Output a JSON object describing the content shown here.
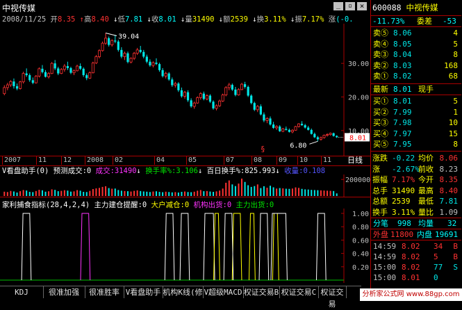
{
  "window": {
    "title": "中视传媒",
    "stock_code": "600088",
    "stock_name": "中视传媒"
  },
  "window_controls": {
    "minimize": "_",
    "restore": "▫",
    "close": "×"
  },
  "info_bar": {
    "date": "2008/11/25",
    "open_label": "开",
    "open": "8.35",
    "high_label": "高",
    "high": "8.40",
    "low_label": "低",
    "low": "7.81",
    "close_label": "收",
    "close": "8.01",
    "volume_label": "量",
    "volume": "31490",
    "amount_label": "额",
    "amount": "2539",
    "turnover_label": "换",
    "turnover": "3.11%",
    "amplitude_label": "振",
    "amplitude": "7.17%",
    "change_label": "涨",
    "change": "(-0."
  },
  "price_chart": {
    "y_ticks": [
      "30.00",
      "20.00",
      "10.00"
    ],
    "max_label": "39.04",
    "min_label": "6.80",
    "current_price": "8.01",
    "marker": "§",
    "x_labels": [
      "2007",
      "11",
      "12",
      "2008",
      "02",
      "04",
      "05",
      "07",
      "08",
      "09",
      "10",
      "11"
    ],
    "period_label": "日线",
    "y_domain": [
      5,
      41
    ],
    "candles": [
      [
        21,
        23.5,
        20.5,
        22.8
      ],
      [
        22.8,
        24.2,
        22.0,
        23.6
      ],
      [
        23.6,
        25.0,
        23.0,
        24.6
      ],
      [
        24.6,
        25.5,
        22.5,
        23.2
      ],
      [
        23.2,
        24.0,
        22.0,
        22.5
      ],
      [
        22.5,
        24.8,
        22.2,
        24.5
      ],
      [
        24.5,
        27.5,
        24.0,
        27.0
      ],
      [
        27,
        28.5,
        26.0,
        26.5
      ],
      [
        26.5,
        27.0,
        24.5,
        25.0
      ],
      [
        25,
        25.8,
        23.8,
        24.2
      ],
      [
        24.2,
        26.5,
        24.0,
        26.2
      ],
      [
        26.2,
        28.8,
        25.8,
        28.4
      ],
      [
        28.4,
        29.5,
        27.0,
        27.4
      ],
      [
        27.4,
        28.0,
        25.8,
        26.0
      ],
      [
        26,
        27.4,
        25.5,
        27.0
      ],
      [
        27,
        30.4,
        26.8,
        30.0
      ],
      [
        30,
        31.0,
        28.0,
        28.5
      ],
      [
        28.5,
        29.0,
        26.5,
        27.0
      ],
      [
        27,
        28.6,
        26.8,
        28.2
      ],
      [
        28.2,
        29.8,
        27.5,
        29.2
      ],
      [
        29.2,
        30.5,
        28.0,
        28.6
      ],
      [
        28.6,
        29.0,
        26.8,
        27.2
      ],
      [
        27.2,
        28.2,
        26.5,
        27.8
      ],
      [
        27.8,
        29.6,
        27.6,
        29.2
      ],
      [
        29.2,
        30.0,
        28.0,
        28.4
      ],
      [
        28.4,
        28.8,
        26.0,
        26.5
      ],
      [
        26.5,
        27.0,
        25.0,
        25.6
      ],
      [
        25.6,
        27.6,
        25.4,
        27.2
      ],
      [
        27.2,
        30.5,
        27.0,
        30.1
      ],
      [
        30.1,
        32.5,
        29.8,
        32.0
      ],
      [
        32,
        34.2,
        31.5,
        33.8
      ],
      [
        33.8,
        36.5,
        33.5,
        36.0
      ],
      [
        36,
        39.04,
        35.5,
        37.5
      ],
      [
        37.5,
        38.0,
        35.0,
        35.5
      ],
      [
        35.5,
        37.2,
        35.0,
        36.8
      ],
      [
        36.8,
        38.5,
        36.0,
        36.5
      ],
      [
        36.5,
        37.0,
        33.5,
        34.0
      ],
      [
        34,
        34.8,
        31.5,
        32.0
      ],
      [
        32,
        33.5,
        31.0,
        33.0
      ],
      [
        33,
        33.5,
        30.0,
        30.4
      ],
      [
        30.4,
        31.8,
        30.0,
        31.5
      ],
      [
        31.5,
        33.4,
        31.0,
        33.0
      ],
      [
        33,
        34.6,
        32.5,
        34.0
      ],
      [
        34,
        35.2,
        33.0,
        33.4
      ],
      [
        33.4,
        34.0,
        31.5,
        32.0
      ],
      [
        32,
        32.6,
        30.0,
        30.5
      ],
      [
        30.5,
        31.2,
        29.0,
        29.4
      ],
      [
        29.4,
        30.6,
        28.8,
        30.2
      ],
      [
        30.2,
        31.5,
        29.5,
        29.8
      ],
      [
        29.8,
        30.2,
        27.5,
        28.0
      ],
      [
        28,
        28.6,
        25.8,
        26.2
      ],
      [
        26.2,
        27.5,
        25.5,
        27.0
      ],
      [
        27,
        27.4,
        24.8,
        25.2
      ],
      [
        25.2,
        25.8,
        23.0,
        23.5
      ],
      [
        23.5,
        24.5,
        22.8,
        24.0
      ],
      [
        24,
        24.4,
        21.5,
        22.0
      ],
      [
        22,
        22.8,
        19.8,
        20.2
      ],
      [
        20.2,
        21.8,
        19.5,
        21.4
      ],
      [
        21.4,
        22.0,
        18.5,
        19.0
      ],
      [
        19,
        19.6,
        16.8,
        17.2
      ],
      [
        17.2,
        18.6,
        16.5,
        18.2
      ],
      [
        18.2,
        20.2,
        18.0,
        19.8
      ],
      [
        19.8,
        21.4,
        19.2,
        21.0
      ],
      [
        21,
        21.6,
        19.0,
        19.4
      ],
      [
        19.4,
        20.8,
        19.0,
        20.4
      ],
      [
        20.4,
        20.8,
        18.2,
        18.6
      ],
      [
        18.6,
        19.0,
        16.2,
        16.6
      ],
      [
        16.6,
        17.8,
        16.0,
        17.4
      ],
      [
        17.4,
        19.2,
        17.0,
        18.8
      ],
      [
        18.8,
        21.0,
        18.5,
        20.6
      ],
      [
        20.6,
        23.2,
        20.2,
        22.8
      ],
      [
        22.8,
        24.2,
        22.0,
        23.6
      ],
      [
        23.6,
        24.0,
        21.8,
        22.2
      ],
      [
        22.2,
        23.0,
        20.2,
        20.6
      ],
      [
        20.6,
        22.6,
        20.4,
        22.2
      ],
      [
        22.2,
        24.2,
        22.0,
        23.8
      ],
      [
        23.8,
        24.5,
        22.5,
        23.0
      ],
      [
        23,
        23.4,
        20.0,
        20.4
      ],
      [
        20.4,
        20.8,
        17.8,
        18.2
      ],
      [
        18.2,
        18.6,
        15.8,
        16.2
      ],
      [
        16.2,
        17.6,
        15.5,
        17.2
      ],
      [
        17.2,
        17.8,
        14.5,
        14.8
      ],
      [
        14.8,
        15.4,
        12.5,
        13.0
      ],
      [
        13,
        14.0,
        12.2,
        13.6
      ],
      [
        13.6,
        14.2,
        11.5,
        11.8
      ],
      [
        11.8,
        12.6,
        10.5,
        10.8
      ],
      [
        10.8,
        11.6,
        10.2,
        11.2
      ],
      [
        11.2,
        11.6,
        9.6,
        9.8
      ],
      [
        9.8,
        10.8,
        9.5,
        10.5
      ],
      [
        10.5,
        11.2,
        10.0,
        10.2
      ],
      [
        10.2,
        10.6,
        9.4,
        9.6
      ],
      [
        9.6,
        10.4,
        9.2,
        10.1
      ],
      [
        10.1,
        11.4,
        10.0,
        11.2
      ],
      [
        11.2,
        12.2,
        10.9,
        12.0
      ],
      [
        12,
        12.8,
        11.4,
        11.6
      ],
      [
        11.6,
        12.0,
        10.6,
        10.9
      ],
      [
        10.9,
        11.4,
        10.0,
        10.2
      ],
      [
        10.2,
        10.6,
        8.8,
        9.0
      ],
      [
        9,
        9.4,
        7.8,
        8.0
      ],
      [
        8,
        8.4,
        6.8,
        7.4
      ],
      [
        7.4,
        8.2,
        7.0,
        7.9
      ],
      [
        7.9,
        8.8,
        7.6,
        8.6
      ],
      [
        8.6,
        9.2,
        8.2,
        8.8
      ],
      [
        8.8,
        9.4,
        8.5,
        9.2
      ],
      [
        9.2,
        9.4,
        8.2,
        8.4
      ],
      [
        8.4,
        8.6,
        7.81,
        8.01
      ]
    ]
  },
  "volume_panel": {
    "title": "V看盘助手(0) 预测成交:0",
    "volume_label": "成交:31490",
    "turnover_label": "换手率%:3.106",
    "hundred_day_label": "百日换手%:825.993",
    "purchase_label": "收量:0.108",
    "y_ticks": [
      "200000"
    ],
    "y_domain": [
      0,
      260000
    ],
    "volumes": [
      52000,
      48000,
      61000,
      55000,
      42000,
      58000,
      72000,
      66000,
      50000,
      47000,
      60000,
      75000,
      69000,
      52000,
      57000,
      80000,
      74000,
      58000,
      62000,
      70000,
      65000,
      53000,
      56000,
      71000,
      64000,
      50000,
      48000,
      62000,
      84000,
      92000,
      98000,
      110000,
      118000,
      96000,
      88000,
      90000,
      72000,
      64000,
      60000,
      58000,
      54000,
      62000,
      68000,
      60000,
      55000,
      52000,
      48000,
      54000,
      57000,
      50000,
      46000,
      52000,
      48000,
      44000,
      47000,
      42000,
      50000,
      54000,
      48000,
      46000,
      52000,
      64000,
      72000,
      58000,
      60000,
      54000,
      50000,
      56000,
      66000,
      90000,
      160000,
      188000,
      140000,
      120000,
      150000,
      210000,
      170000,
      130000,
      110000,
      120000,
      140000,
      96000,
      118000,
      100000,
      124000,
      105000,
      90000,
      96000,
      92000,
      88000,
      86000,
      90000,
      104000,
      98000,
      86000,
      80000,
      78000,
      74000,
      72000,
      70000,
      68000,
      66000,
      64000,
      62000,
      60000,
      31490
    ]
  },
  "indicator_panel": {
    "name": "家利捕食指标",
    "params": "(28,4,2,4)",
    "line1": "主力建仓提醒:0",
    "line2": "大户减仓:0",
    "line3": "机构出货:0",
    "line4": "主力出货:0",
    "y_ticks": [
      "1.00",
      "0.80",
      "0.60",
      "0.40",
      "0.20"
    ],
    "signals": [
      {
        "type": "line4",
        "start": 0.06,
        "end": 0.08,
        "color": "#ffffff"
      },
      {
        "type": "line3",
        "start": 0.235,
        "end": 0.255,
        "color": "#ff33ff"
      },
      {
        "type": "line4",
        "start": 0.485,
        "end": 0.505,
        "color": "#ffffff"
      },
      {
        "type": "line4",
        "start": 0.53,
        "end": 0.55,
        "color": "#ffffff"
      },
      {
        "type": "line4",
        "start": 0.6,
        "end": 0.625,
        "color": "#ffffff"
      },
      {
        "type": "line2",
        "start": 0.63,
        "end": 0.64,
        "color": "#ffff00"
      },
      {
        "type": "line2",
        "start": 0.685,
        "end": 0.705,
        "color": "#ffff00"
      },
      {
        "type": "line4",
        "start": 0.66,
        "end": 0.68,
        "color": "#ffffff"
      },
      {
        "type": "line2",
        "start": 0.735,
        "end": 0.745,
        "color": "#ffff00"
      },
      {
        "type": "line4",
        "start": 0.765,
        "end": 0.785,
        "color": "#ffffff"
      },
      {
        "type": "line2",
        "start": 0.805,
        "end": 0.815,
        "color": "#ffff00"
      },
      {
        "type": "line4",
        "start": 0.8,
        "end": 0.84,
        "color": "#ffffff"
      },
      {
        "type": "line4",
        "start": 0.935,
        "end": 0.955,
        "color": "#ffffff"
      }
    ]
  },
  "bottom_tabs": [
    "KDJ",
    "很准加强",
    "很准胜率",
    "V看盘助手",
    "机构K线(修",
    "V超级MACD",
    "权证交易B",
    "权证交易C",
    "权证交易"
  ],
  "right_panel": {
    "weibi_label": "委比",
    "weibi_value": "-11.73%",
    "weicha_label": "委差",
    "weicha_value": "-53",
    "sell_orders": [
      {
        "label": "卖⑤",
        "price": "8.06",
        "vol": "4"
      },
      {
        "label": "卖④",
        "price": "8.05",
        "vol": "5"
      },
      {
        "label": "卖③",
        "price": "8.04",
        "vol": "8"
      },
      {
        "label": "卖②",
        "price": "8.03",
        "vol": "168"
      },
      {
        "label": "卖①",
        "price": "8.02",
        "vol": "68"
      }
    ],
    "latest_label": "最新",
    "latest_value": "8.01",
    "current_hand_label": "现手",
    "buy_orders": [
      {
        "label": "买①",
        "price": "8.01",
        "vol": "5"
      },
      {
        "label": "买②",
        "price": "7.99",
        "vol": "1"
      },
      {
        "label": "买③",
        "price": "7.98",
        "vol": "10"
      },
      {
        "label": "买④",
        "price": "7.97",
        "vol": "15"
      },
      {
        "label": "买⑤",
        "price": "7.95",
        "vol": "8"
      }
    ],
    "stats": [
      {
        "l1": "涨跌",
        "v1": "-0.22",
        "l2": "均价",
        "v2": "8.06"
      },
      {
        "l1": "涨",
        "v1": "-2.67%",
        "l2": "前收",
        "v2": "8.23"
      },
      {
        "l1": "振幅",
        "v1": "7.17%",
        "l2": "今开",
        "v2": "8.35"
      },
      {
        "l1": "总手",
        "v1": "31490",
        "l2": "最高",
        "v2": "8.40"
      },
      {
        "l1": "总额",
        "v1": "2539",
        "l2": "最低",
        "v2": "7.81"
      },
      {
        "l1": "换手",
        "v1": "3.11%",
        "l2": "量比",
        "v2": "1.09"
      }
    ],
    "fenbi_label": "分笔",
    "fenbi_value": "998",
    "junliang_label": "均量",
    "junliang_value": "32",
    "waipan_label": "外盘",
    "waipan_value": "11800",
    "neipan_label": "内盘",
    "neipan_value": "19691",
    "ticks": [
      {
        "time": "14:59",
        "price": "8.02",
        "vol": "34",
        "side": "B"
      },
      {
        "time": "14:59",
        "price": "8.02",
        "vol": "5",
        "side": "B"
      },
      {
        "time": "15:00",
        "price": "8.02",
        "vol": "77",
        "side": "S"
      },
      {
        "time": "15:00",
        "price": "8.01",
        "vol": "0",
        "side": ""
      }
    ],
    "watermark": "分析家公式网 www.88gp.com"
  },
  "colors": {
    "up": "#ff3232",
    "down": "#00e6e6",
    "bg": "#000000",
    "border": "#aa0000"
  }
}
